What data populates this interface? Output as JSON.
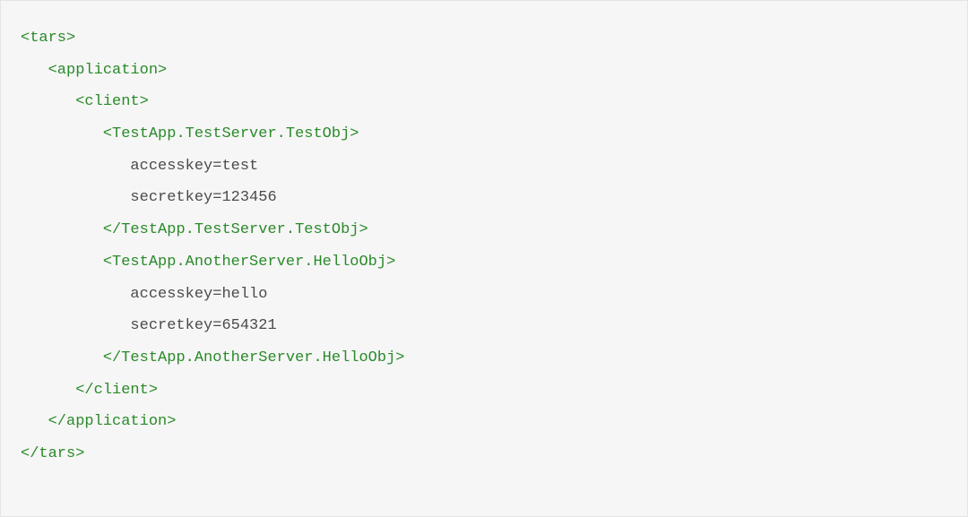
{
  "code": {
    "lines": [
      {
        "indent": 0,
        "kind": "tag",
        "text": "<tars>"
      },
      {
        "indent": 1,
        "kind": "tag",
        "text": "<application>"
      },
      {
        "indent": 2,
        "kind": "tag",
        "text": "<client>"
      },
      {
        "indent": 3,
        "kind": "tag",
        "text": "<TestApp.TestServer.TestObj>"
      },
      {
        "indent": 4,
        "kind": "plain",
        "text": "accesskey=test"
      },
      {
        "indent": 4,
        "kind": "plain",
        "text": "secretkey=123456"
      },
      {
        "indent": 3,
        "kind": "tag",
        "text": "</TestApp.TestServer.TestObj>"
      },
      {
        "indent": 3,
        "kind": "tag",
        "text": "<TestApp.AnotherServer.HelloObj>"
      },
      {
        "indent": 4,
        "kind": "plain",
        "text": "accesskey=hello"
      },
      {
        "indent": 4,
        "kind": "plain",
        "text": "secretkey=654321"
      },
      {
        "indent": 3,
        "kind": "tag",
        "text": "</TestApp.AnotherServer.HelloObj>"
      },
      {
        "indent": 2,
        "kind": "tag",
        "text": "</client>"
      },
      {
        "indent": 1,
        "kind": "tag",
        "text": "</application>"
      },
      {
        "indent": 0,
        "kind": "tag",
        "text": "</tars>"
      }
    ]
  },
  "colors": {
    "tag": "#2a8a2a",
    "plain": "#4b4b4b",
    "bg": "#f6f6f6",
    "border": "#e5e5e5"
  }
}
